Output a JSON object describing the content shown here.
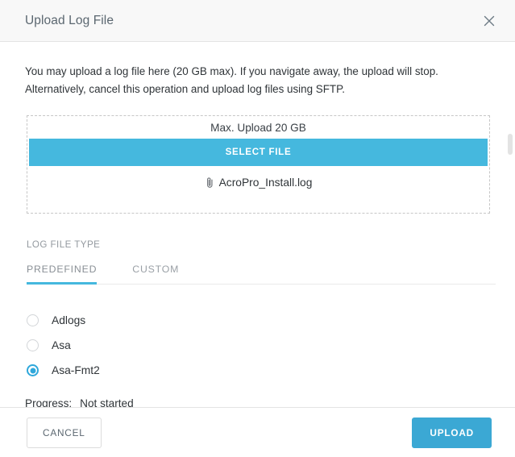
{
  "dialog": {
    "title": "Upload Log File",
    "close_icon": "close-icon",
    "intro_text": "You may upload a log file here (20 GB max). If you navigate away, the upload will stop. Alternatively, cancel this operation and upload log files using SFTP."
  },
  "dropzone": {
    "max_upload_label": "Max. Upload 20 GB",
    "select_file_label": "SELECT FILE",
    "attachment_icon": "paperclip-icon",
    "file_name": "AcroPro_Install.log"
  },
  "log_file_type": {
    "section_label": "LOG FILE TYPE",
    "tabs": [
      {
        "label": "PREDEFINED",
        "active": true
      },
      {
        "label": "CUSTOM",
        "active": false
      }
    ],
    "options": [
      {
        "label": "Adlogs",
        "selected": false
      },
      {
        "label": "Asa",
        "selected": false
      },
      {
        "label": "Asa-Fmt2",
        "selected": true
      }
    ]
  },
  "progress": {
    "label": "Progress:",
    "value": "Not started",
    "percent": 0
  },
  "footer": {
    "cancel_label": "CANCEL",
    "upload_label": "UPLOAD"
  },
  "colors": {
    "accent": "#45b8de",
    "accent_button": "#3ba8d4",
    "radio_selected": "#2fa8db",
    "header_bg": "#f8f8f8",
    "border": "#e4e4e4"
  }
}
